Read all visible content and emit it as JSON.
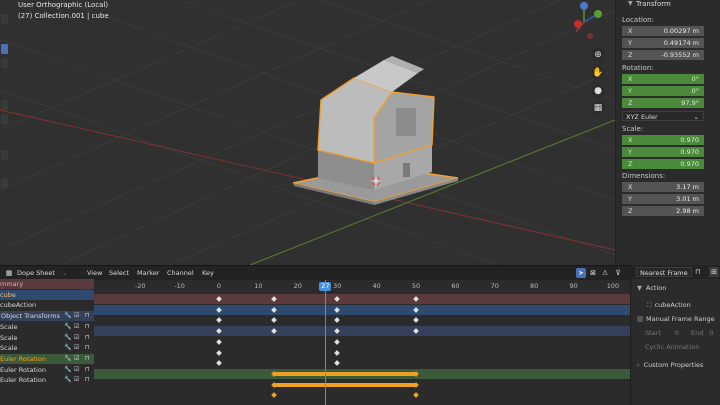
{
  "viewport": {
    "mode": "User Orthographic (Local)",
    "collection": "(27) Collection.001 | cube",
    "nav_labels": {
      "y": "Y",
      "z": "Z",
      "x": "X"
    }
  },
  "transform_panel": {
    "title": "Transform",
    "location_label": "Location:",
    "location": [
      {
        "axis": "X",
        "value": "0.00297 m"
      },
      {
        "axis": "Y",
        "value": "0.49174 m"
      },
      {
        "axis": "Z",
        "value": "-0.93552 m"
      }
    ],
    "rotation_label": "Rotation:",
    "rotation": [
      {
        "axis": "X",
        "value": "0°"
      },
      {
        "axis": "Y",
        "value": "0°"
      },
      {
        "axis": "Z",
        "value": "97.9°"
      }
    ],
    "rotation_mode": "XYZ Euler",
    "scale_label": "Scale:",
    "scale": [
      {
        "axis": "X",
        "value": "0.970"
      },
      {
        "axis": "Y",
        "value": "0.970"
      },
      {
        "axis": "Z",
        "value": "0.970"
      }
    ],
    "dimensions_label": "Dimensions:",
    "dimensions": [
      {
        "axis": "X",
        "value": "3.17 m"
      },
      {
        "axis": "Y",
        "value": "3.01 m"
      },
      {
        "axis": "Z",
        "value": "2.98 m"
      }
    ]
  },
  "dope_sheet": {
    "editor": "Dope Sheet",
    "menus": [
      "View",
      "Select",
      "Marker",
      "Channel",
      "Key"
    ],
    "snap": "Nearest Frame",
    "current_frame": "27",
    "ruler": [
      "-20",
      "-10",
      "0",
      "10",
      "20",
      "30",
      "40",
      "50",
      "60",
      "70",
      "80",
      "90",
      "100"
    ],
    "channels": [
      {
        "label": "mmary",
        "color": "#d8b0b0",
        "bg": "#5a3a3c",
        "icons": false
      },
      {
        "label": "cube",
        "color": "#f0c080",
        "bg": "#2e4a6e",
        "icons": false
      },
      {
        "label": "cubeAction",
        "color": "#d8d8d8",
        "bg": "#2b2b2b",
        "icons": false
      },
      {
        "label": "Object Transforms",
        "color": "#d8d8d8",
        "bg": "#35405a",
        "icons": true
      },
      {
        "label": "Scale",
        "color": "#d8d8d8",
        "bg": "#2b2b2b",
        "icons": true
      },
      {
        "label": "Scale",
        "color": "#d8d8d8",
        "bg": "#2b2b2b",
        "icons": true
      },
      {
        "label": "Scale",
        "color": "#d8d8d8",
        "bg": "#2b2b2b",
        "icons": true
      },
      {
        "label": "Euler Rotation",
        "color": "#f0a020",
        "bg": "#3a5a3a",
        "icons": true
      },
      {
        "label": "Euler Rotation",
        "color": "#d8d8d8",
        "bg": "#2b2b2b",
        "icons": true
      },
      {
        "label": "Euler Rotation",
        "color": "#d8d8d8",
        "bg": "#2b2b2b",
        "icons": true
      }
    ],
    "keyframes": [
      {
        "row": 0,
        "frames": [
          0,
          14,
          30,
          50
        ]
      },
      {
        "row": 1,
        "frames": [
          0,
          14,
          30,
          50
        ]
      },
      {
        "row": 2,
        "frames": [
          0,
          14,
          30,
          50
        ]
      },
      {
        "row": 3,
        "frames": [
          0,
          14,
          30,
          50
        ]
      },
      {
        "row": 4,
        "frames": [
          0,
          30
        ]
      },
      {
        "row": 5,
        "frames": [
          0,
          30
        ]
      },
      {
        "row": 6,
        "frames": [
          0,
          30
        ]
      },
      {
        "row": 7,
        "frames": [
          14,
          50
        ],
        "hold": [
          14,
          50
        ],
        "orange": true
      },
      {
        "row": 8,
        "frames": [
          14,
          50
        ],
        "hold": [
          14,
          50
        ],
        "orange": true
      },
      {
        "row": 9,
        "frames": [
          14,
          50
        ],
        "orange": true
      }
    ]
  },
  "action_panel": {
    "title": "Action",
    "action_name": "cubeAction",
    "manual_range": "Manual Frame Range",
    "start_label": "Start",
    "start_value": "0",
    "end_label": "End",
    "end_value": "0",
    "cyclic": "Cyclic Animation",
    "custom_props": "Custom Properties"
  }
}
